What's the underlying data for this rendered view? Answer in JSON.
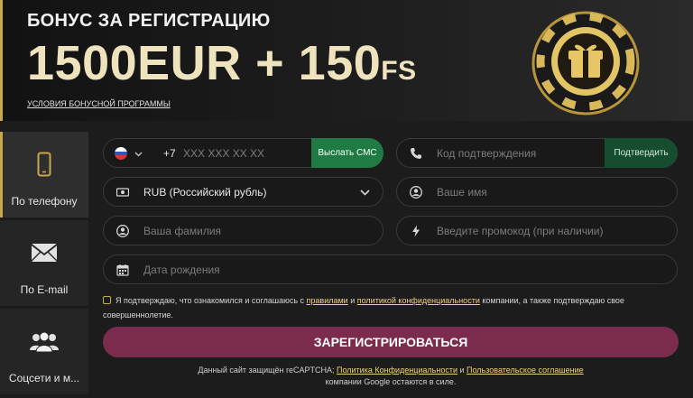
{
  "banner": {
    "title": "БОНУС ЗА РЕГИСТРАЦИЮ",
    "amount": "1500EUR + 150",
    "amount_suffix": "FS",
    "terms_link": "УСЛОВИЯ БОНУСНОЙ ПРОГРАММЫ"
  },
  "tabs": [
    {
      "label": "По телефону",
      "icon": "phone-icon",
      "active": true
    },
    {
      "label": "По E-mail",
      "icon": "envelope-icon",
      "active": false
    },
    {
      "label": "Соцсети и м...",
      "icon": "users-icon",
      "active": false
    }
  ],
  "form": {
    "phone": {
      "country": "RU",
      "code": "+7",
      "placeholder": "XXX XXX XX XX",
      "sms_button": "Выслать СМС"
    },
    "confirm": {
      "placeholder": "Код подтверждения",
      "button": "Подтвердить"
    },
    "currency": {
      "value": "RUB (Российский рубль)"
    },
    "name": {
      "placeholder": "Ваше имя"
    },
    "surname": {
      "placeholder": "Ваша фамилия"
    },
    "promo": {
      "placeholder": "Введите промокод (при наличии)"
    },
    "birthdate": {
      "placeholder": "Дата рождения"
    },
    "consent": {
      "part1": "Я подтверждаю, что ознакомился и соглашаюсь с ",
      "link1": "правилами",
      "part2": " и ",
      "link2": "политикой конфиденциальности",
      "part3": " компании, а также подтверждаю свое совершеннолетие."
    },
    "submit_label": "ЗАРЕГИСТРИРОВАТЬСЯ",
    "recaptcha": {
      "part1": "Данный сайт защищён reCAPTCHA; ",
      "link1": "Политика Конфиденциальности",
      "part2": " и ",
      "link2": "Пользовательское соглашение",
      "part3": "компании Google остаются в силе."
    }
  },
  "colors": {
    "accent_gold": "#c9a84a",
    "submit": "#7b2c4c",
    "sms_green": "#1f7a43"
  }
}
